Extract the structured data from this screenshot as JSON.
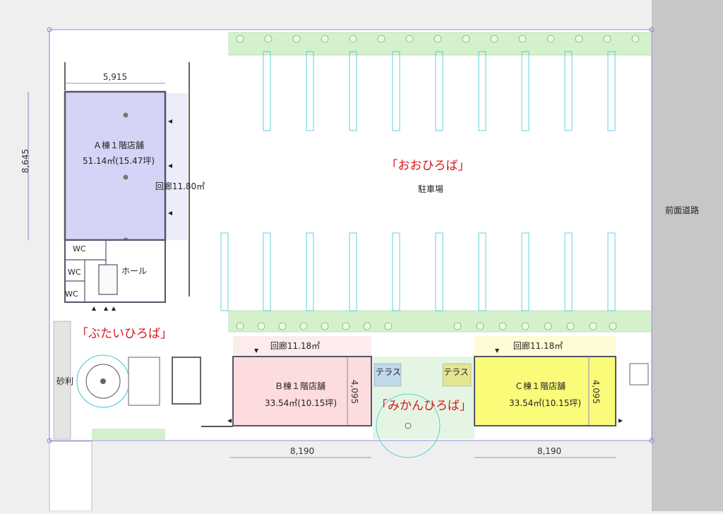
{
  "colors": {
    "store_a": "#d4d4f6",
    "store_b": "#fcdcdc",
    "store_c": "#fbfb7a",
    "hall_c": "#fffbd6",
    "hall_b": "#fdecec",
    "green_strip": "#d4f1cc",
    "road": "#c7c7c7",
    "parking_line": "#39c6d8",
    "label_red": "#d8161b"
  },
  "labels": {
    "store_a_name": "Ａ棟１階店舗",
    "store_a_area": "51.14㎡(15.47坪)",
    "corridor_a": "回廊11.80㎡",
    "wc1": "WC",
    "wc2": "WC",
    "wc3": "WC",
    "hall": "ホール",
    "oohiroba": "「おおひろば」",
    "parking": "駐車場",
    "road": "前面道路",
    "butai": "「ぶたいひろば」",
    "gravel": "砂利",
    "corridor_b": "回廊11.18㎡",
    "corridor_c": "回廊11.18㎡",
    "store_b_name": "Ｂ棟１階店舗",
    "store_b_area": "33.54㎡(10.15坪)",
    "store_c_name": "Ｃ棟１階店舗",
    "store_c_area": "33.54㎡(10.15坪)",
    "terrace_left": "テラス",
    "terrace_right": "テラス",
    "mikan": "「みかんひろば」"
  },
  "dimensions": {
    "a_width": "5,915",
    "a_height": "8,645",
    "b_height": "4,095",
    "c_height": "4,095",
    "b_width": "8,190",
    "c_width": "8,190"
  }
}
